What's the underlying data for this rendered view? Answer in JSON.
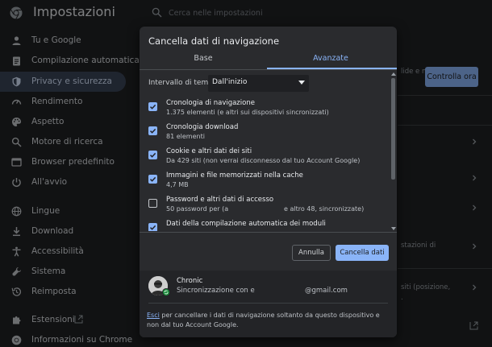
{
  "header": {
    "title": "Impostazioni",
    "search_placeholder": "Cerca nelle impostazioni"
  },
  "sidebar": {
    "items": [
      {
        "label": "Tu e Google",
        "icon": "person-icon",
        "active": false
      },
      {
        "label": "Compilazione automatica",
        "icon": "clipboard-icon",
        "active": false
      },
      {
        "label": "Privacy e sicurezza",
        "icon": "shield-icon",
        "active": true
      },
      {
        "label": "Rendimento",
        "icon": "gauge-icon",
        "active": false
      },
      {
        "label": "Aspetto",
        "icon": "palette-icon",
        "active": false
      },
      {
        "label": "Motore di ricerca",
        "icon": "search-icon",
        "active": false
      },
      {
        "label": "Browser predefinito",
        "icon": "browser-icon",
        "active": false
      },
      {
        "label": "All'avvio",
        "icon": "power-icon",
        "active": false
      },
      {
        "label": "Lingue",
        "icon": "globe-icon",
        "active": false
      },
      {
        "label": "Download",
        "icon": "download-icon",
        "active": false
      },
      {
        "label": "Accessibilità",
        "icon": "accessibility-icon",
        "active": false
      },
      {
        "label": "Sistema",
        "icon": "wrench-icon",
        "active": false
      },
      {
        "label": "Reimposta",
        "icon": "history-icon",
        "active": false
      },
      {
        "label": "Estensioni",
        "icon": "puzzle-icon",
        "active": false
      },
      {
        "label": "Informazioni su Chrome",
        "icon": "chrome-icon",
        "active": false
      }
    ]
  },
  "background": {
    "sync_button": "Controlla ora",
    "fragment_a": "lide e non",
    "fragment_b": "stazioni di",
    "fragment_c": "siti (posizione,",
    "fragment_d": "."
  },
  "dialog": {
    "title": "Cancella dati di navigazione",
    "tabs": [
      {
        "label": "Base",
        "selected": false
      },
      {
        "label": "Avanzate",
        "selected": true
      }
    ],
    "time_range": {
      "label": "Intervallo di tempo",
      "value": "Dall'inizio"
    },
    "options": [
      {
        "title": "Cronologia di navigazione",
        "subtitle": "1.375 elementi (e altri sui dispositivi sincronizzati)",
        "subtitle_tail": "",
        "checked": true
      },
      {
        "title": "Cronologia download",
        "subtitle": "81 elementi",
        "subtitle_tail": "",
        "checked": true
      },
      {
        "title": "Cookie e altri dati dei siti",
        "subtitle": "Da 429 siti (non verrai disconnesso dal tuo Account Google)",
        "subtitle_tail": "",
        "checked": true
      },
      {
        "title": "Immagini e file memorizzati nella cache",
        "subtitle": "4,7 MB",
        "subtitle_tail": "",
        "checked": true
      },
      {
        "title": "Password e altri dati di accesso",
        "subtitle": "50 password per (a",
        "subtitle_tail": "e altro 48, sincronizzate)",
        "checked": false
      },
      {
        "title": "Dati della compilazione automatica dei moduli",
        "subtitle": "",
        "subtitle_tail": "",
        "checked": true
      }
    ],
    "cancel_label": "Annulla",
    "clear_label": "Cancella dati",
    "account": {
      "name": "Chronic",
      "sync_prefix": "Sincronizzazione con e",
      "email_suffix": "@gmail.com"
    },
    "signout": {
      "link": "Esci",
      "text": " per cancellare i dati di navigazione soltanto da questo dispositivo e non dal tuo Account Google."
    }
  },
  "colors": {
    "accent": "#8ab4f8",
    "background": "#202124",
    "dialog": "#2a2b2e",
    "active_nav": "#394457"
  }
}
